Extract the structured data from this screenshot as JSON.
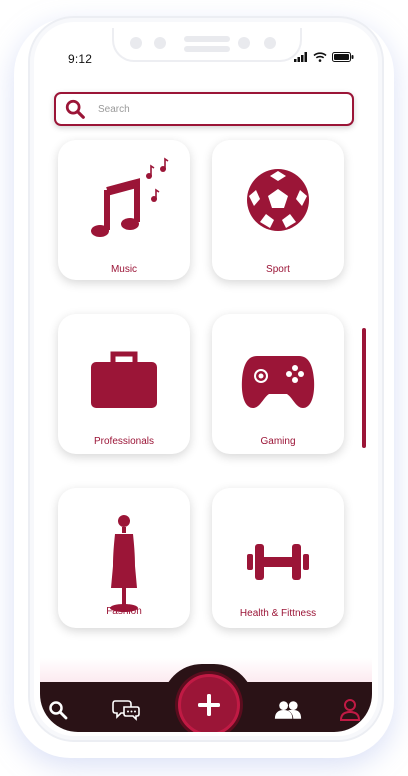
{
  "status_bar": {
    "time": "9:12"
  },
  "search": {
    "placeholder": "Search"
  },
  "categories": [
    {
      "label": "Music",
      "icon": "music-notes-icon"
    },
    {
      "label": "Sport",
      "icon": "soccer-ball-icon"
    },
    {
      "label": "Professionals",
      "icon": "briefcase-icon"
    },
    {
      "label": "Gaming",
      "icon": "gamepad-icon"
    },
    {
      "label": "Fashion",
      "icon": "dress-mannequin-icon"
    },
    {
      "label": "Health & Fittness",
      "icon": "dumbbell-icon"
    }
  ],
  "bottom_nav": [
    {
      "icon": "search-icon"
    },
    {
      "icon": "chat-icon"
    },
    {
      "icon": "add-icon"
    },
    {
      "icon": "people-icon"
    },
    {
      "icon": "profile-icon"
    }
  ],
  "colors": {
    "accent": "#9b1537",
    "nav_bg": "#2a1216"
  }
}
